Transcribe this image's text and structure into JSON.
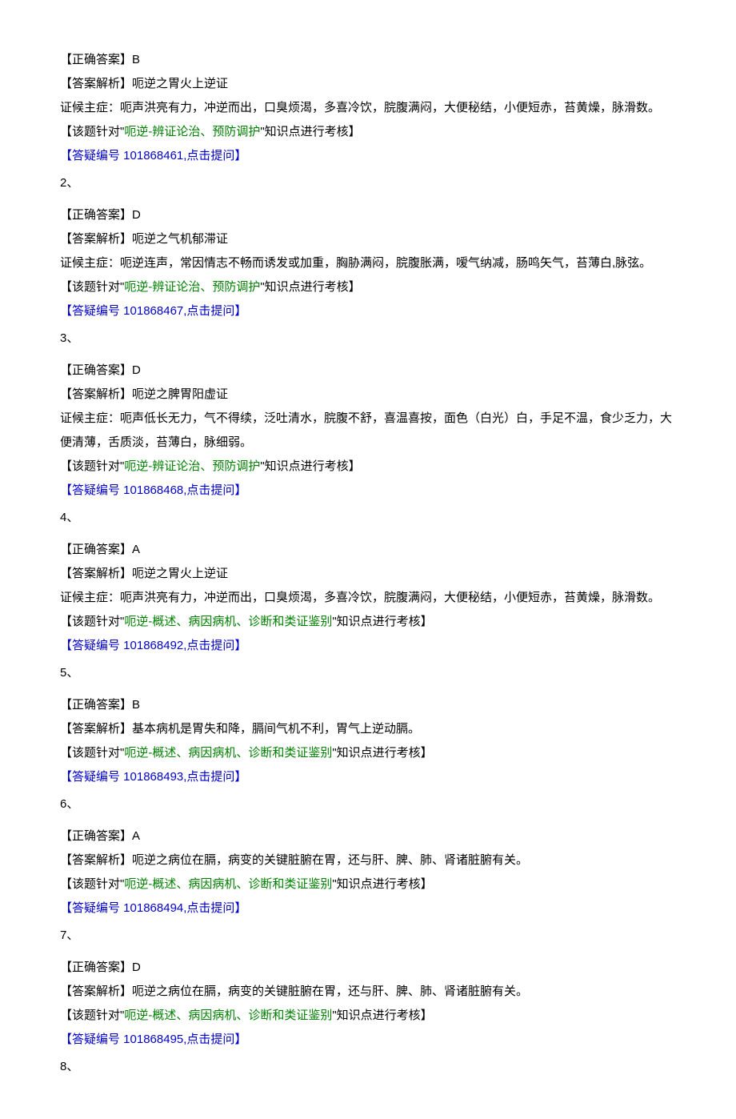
{
  "items": [
    {
      "num": "",
      "correct": "【正确答案】B",
      "analysis_head": "【答案解析】呃逆之胃火上逆证",
      "symptom": "证候主症：呃声洪亮有力，冲逆而出，口臭烦渴，多喜冷饮，脘腹满闷，大便秘结，小便短赤，苔黄燥，脉滑数。",
      "topic_prefix": "【该题针对\"",
      "topic_green": "呃逆-辨证论治、预防调护",
      "topic_suffix": "\"知识点进行考核】",
      "qnum": "【答疑编号 101868461,点击提问】",
      "next": "2、"
    },
    {
      "num": "",
      "correct": "【正确答案】D",
      "analysis_head": "【答案解析】呃逆之气机郁滞证",
      "symptom": "证候主症：呃逆连声，常因情志不畅而诱发或加重，胸胁满闷，脘腹胀满，嗳气纳减，肠鸣矢气，苔薄白,脉弦。",
      "topic_prefix": "【该题针对\"",
      "topic_green": "呃逆-辨证论治、预防调护",
      "topic_suffix": "\"知识点进行考核】",
      "qnum": "【答疑编号 101868467,点击提问】",
      "next": "3、"
    },
    {
      "num": "",
      "correct": "【正确答案】D",
      "analysis_head": "【答案解析】呃逆之脾胃阳虚证",
      "symptom": "证候主症：呃声低长无力，气不得续，泛吐清水，脘腹不舒，喜温喜按，面色（白光）白，手足不温，食少乏力，大便清薄，舌质淡，苔薄白，脉细弱。",
      "topic_prefix": "【该题针对\"",
      "topic_green": "呃逆-辨证论治、预防调护",
      "topic_suffix": "\"知识点进行考核】",
      "qnum": "【答疑编号 101868468,点击提问】",
      "next": "4、"
    },
    {
      "num": "",
      "correct": "【正确答案】A",
      "analysis_head": "【答案解析】呃逆之胃火上逆证",
      "symptom": "证候主症：呃声洪亮有力，冲逆而出，口臭烦渴，多喜冷饮，脘腹满闷，大便秘结，小便短赤，苔黄燥，脉滑数。",
      "topic_prefix": "【该题针对\"",
      "topic_green": "呃逆-概述、病因病机、诊断和类证鉴别",
      "topic_suffix": "\"知识点进行考核】",
      "qnum": "【答疑编号 101868492,点击提问】",
      "next": "5、"
    },
    {
      "num": "",
      "correct": "【正确答案】B",
      "analysis_head": "【答案解析】基本病机是胃失和降，膈间气机不利，胃气上逆动膈。",
      "symptom": "",
      "topic_prefix": "【该题针对\"",
      "topic_green": "呃逆-概述、病因病机、诊断和类证鉴别",
      "topic_suffix": "\"知识点进行考核】",
      "qnum": "【答疑编号 101868493,点击提问】",
      "next": "6、"
    },
    {
      "num": "",
      "correct": "【正确答案】A",
      "analysis_head": "【答案解析】呃逆之病位在膈，病变的关键脏腑在胃，还与肝、脾、肺、肾诸脏腑有关。",
      "symptom": "",
      "topic_prefix": "【该题针对\"",
      "topic_green": "呃逆-概述、病因病机、诊断和类证鉴别",
      "topic_suffix": "\"知识点进行考核】",
      "qnum": "【答疑编号 101868494,点击提问】",
      "next": "7、"
    },
    {
      "num": "",
      "correct": "【正确答案】D",
      "analysis_head": "【答案解析】呃逆之病位在膈，病变的关键脏腑在胃，还与肝、脾、肺、肾诸脏腑有关。",
      "symptom": "",
      "topic_prefix": "【该题针对\"",
      "topic_green": "呃逆-概述、病因病机、诊断和类证鉴别",
      "topic_suffix": "\"知识点进行考核】",
      "qnum": "【答疑编号 101868495,点击提问】",
      "next": "8、"
    }
  ]
}
